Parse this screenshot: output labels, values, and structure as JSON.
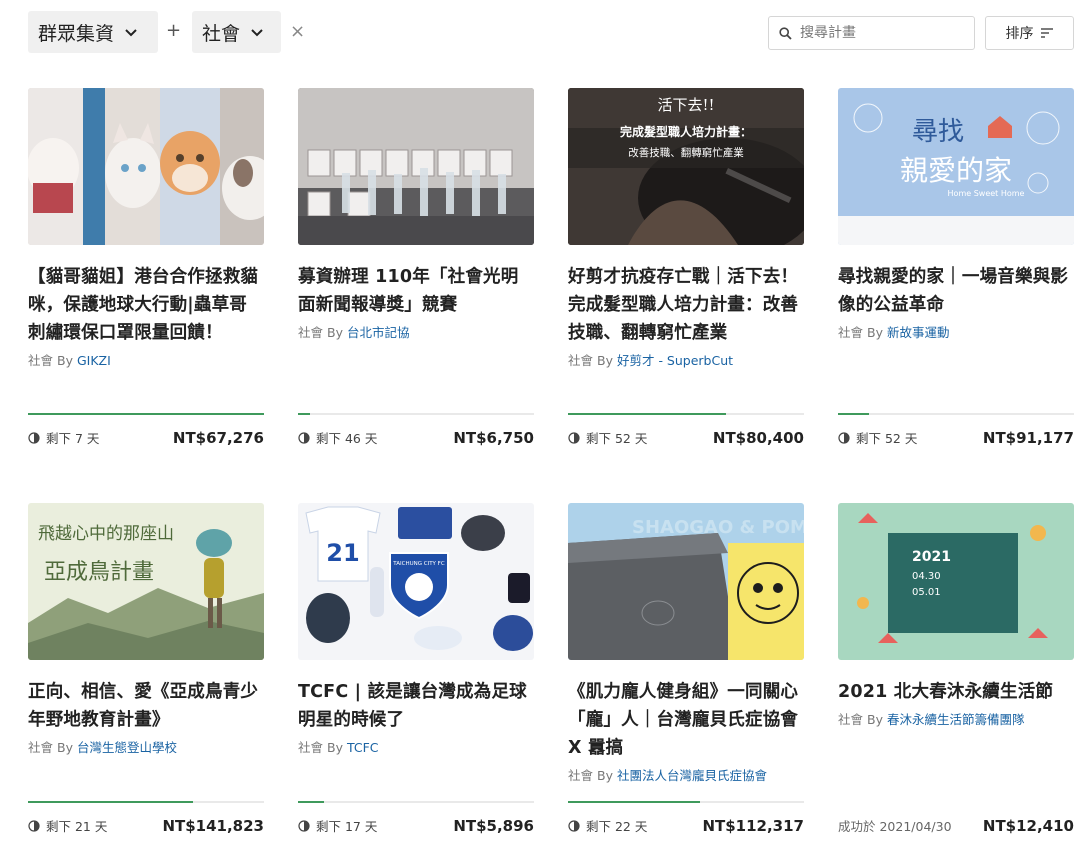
{
  "filters": {
    "group_label": "群眾集資",
    "plus": "+",
    "category_label": "社會",
    "clear": "×"
  },
  "search": {
    "placeholder": "搜尋計畫"
  },
  "sort": {
    "label": "排序"
  },
  "projects": [
    {
      "title": "【貓哥貓姐】港台合作拯救貓咪，保護地球大行動|蟲草哥刺繡環保口罩限量回饋！",
      "category": "社會",
      "by": "By",
      "creator": "GIKZI",
      "remaining": "剩下 7 天",
      "amount": "NT$67,276",
      "progress": 1.0,
      "image": "cats-photo"
    },
    {
      "title": "募資辦理 110年「社會光明面新聞報導獎」競賽",
      "category": "社會",
      "by": "By",
      "creator": "台北市記協",
      "remaining": "剩下 46 天",
      "amount": "NT$6,750",
      "progress": 0.05,
      "image": "trophies-photo"
    },
    {
      "title": "好剪才抗疫存亡戰｜活下去！完成髮型職人培力計畫：改善技職、翻轉窮忙產業",
      "category": "社會",
      "by": "By",
      "creator": "好剪才 - SuperbCut",
      "remaining": "剩下 52 天",
      "amount": "NT$80,400",
      "progress": 0.67,
      "image": "haircut-photo",
      "image_text": {
        "line1": "活下去!!",
        "line2": "完成髮型職人培力計畫：",
        "line3": "改善技職、翻轉窮忙產業"
      }
    },
    {
      "title": "尋找親愛的家｜一場音樂與影像的公益革命",
      "category": "社會",
      "by": "By",
      "creator": "新故事運動",
      "remaining": "剩下 52 天",
      "amount": "NT$91,177",
      "progress": 0.13,
      "image": "home-poster",
      "image_text": {
        "line1": "尋找",
        "line2": "親愛的家",
        "line3": "Home Sweet Home"
      }
    },
    {
      "title": "正向、相信、愛《亞成鳥青少年野地教育計畫》",
      "category": "社會",
      "by": "By",
      "creator": "台灣生態登山學校",
      "remaining": "剩下 21 天",
      "amount": "NT$141,823",
      "progress": 0.7,
      "image": "bird-illustration",
      "image_text": {
        "line1": "飛越心中的那座山",
        "line2": "亞成鳥計畫"
      }
    },
    {
      "title": "TCFC | 該是讓台灣成為足球明星的時候了",
      "category": "社會",
      "by": "By",
      "creator": "TCFC",
      "remaining": "剩下 17 天",
      "amount": "NT$5,896",
      "progress": 0.11,
      "image": "football-merch",
      "image_text": {
        "line1": "21",
        "line2": "TAICHUNG CITY FC"
      }
    },
    {
      "title": "《肌力龐人健身組》一同關心「龐」人｜台灣龐貝氏症協會 X 囂搞",
      "category": "社會",
      "by": "By",
      "creator": "社團法人台灣龐貝氏症協會",
      "remaining": "剩下 22 天",
      "amount": "NT$112,317",
      "progress": 0.56,
      "image": "mat-product",
      "image_text": {
        "line1": "SHAOGAO & POM"
      }
    },
    {
      "title": "2021 北大春沐永續生活節",
      "category": "社會",
      "by": "By",
      "creator": "春沐永續生活節籌備團隊",
      "success": "成功於 2021/04/30",
      "amount": "NT$12,410",
      "progress": 0,
      "image": "festival-poster",
      "image_text": {
        "line1": "2021",
        "line2": "04.30",
        "line3": "05.01"
      }
    }
  ],
  "colors": {
    "accent_green": "#3f9a5c",
    "creator_blue": "#1a63a3"
  }
}
